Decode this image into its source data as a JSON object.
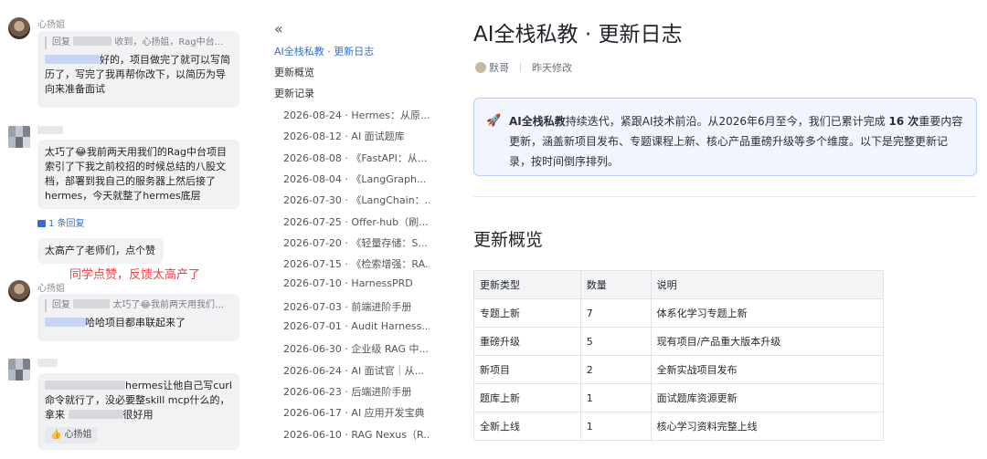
{
  "chat": {
    "messages": [
      {
        "sender": "心扬姐",
        "quote_prefix": "回复",
        "quote_text": "收到，心扬姐，Rag中台的项目做...",
        "body": "好的，项目做完了就可以写简历了，写完了我再帮你改下，以简历为导向来准备面试"
      },
      {
        "body": "太巧了😂我前两天用我们的Rag中台项目索引了下我之前校招的时候总结的八股文档，部署到我自己的服务器上然后接了hermes，今天就整了hermes底层",
        "reply_count": "1 条回复"
      },
      {
        "body": "太高产了老师们，点个赞"
      },
      {
        "sender": "心扬姐",
        "quote_prefix": "回复",
        "quote_text": "太巧了😂我前两天用我们的Rag...",
        "body": "哈哈项目都串联起来了"
      },
      {
        "body_a": "hermes让他自己写curl",
        "body_b": "命令就行了，没必要整skill mcp什么的，",
        "body_c": "拿来",
        "body_d": "很好用",
        "like_label": "心扬姐"
      }
    ],
    "annotation": "同学点赞，反馈太高产了"
  },
  "toc": {
    "collapse_glyph": "«",
    "title": "AI全栈私教 · 更新日志",
    "overview": "更新概览",
    "records": "更新记录",
    "items": [
      "2026-08-24 · Hermes：从原...",
      "2026-08-12 · AI 面试题库",
      "2026-08-08 · 《FastAPI：从...",
      "2026-08-04 · 《LangGraph...",
      "2026-07-30 · 《LangChain：...",
      "2026-07-25 · Offer-hub（刷...",
      "2026-07-20 · 《轻量存储：S...",
      "2026-07-15 · 《检索增强：RA...",
      "2026-07-10 · HarnessPRD",
      "2026-07-03 · 前端进阶手册",
      "2026-07-01 · Audit Harness...",
      "2026-06-30 · 企业级 RAG 中...",
      "2026-06-24 · AI 面试官｜从...",
      "2026-06-23 · 后端进阶手册",
      "2026-06-17 · AI 应用开发宝典",
      "2026-06-10 · RAG Nexus（R..."
    ]
  },
  "doc": {
    "title": "AI全栈私教 · 更新日志",
    "author": "默哥",
    "modified": "昨天修改",
    "callout": {
      "icon": "🚀",
      "strong": "AI全栈私教",
      "text1": "持续迭代，紧跟AI技术前沿。从2026年6月至今，我们已累计完成 ",
      "count": "16 次",
      "text2": "重要内容更新，涵盖新项目发布、专题课程上新、核心产品重磅升级等多个维度。以下是完整更新记录，按时间倒序排列。"
    },
    "section_title": "更新概览",
    "table": {
      "headers": [
        "更新类型",
        "数量",
        "说明"
      ],
      "rows": [
        [
          "专题上新",
          "7",
          "体系化学习专题上新"
        ],
        [
          "重磅升级",
          "5",
          "现有项目/产品重大版本升级"
        ],
        [
          "新项目",
          "2",
          "全新实战项目发布"
        ],
        [
          "题库上新",
          "1",
          "面试题库资源更新"
        ],
        [
          "全新上线",
          "1",
          "核心学习资料完整上线"
        ]
      ]
    }
  }
}
